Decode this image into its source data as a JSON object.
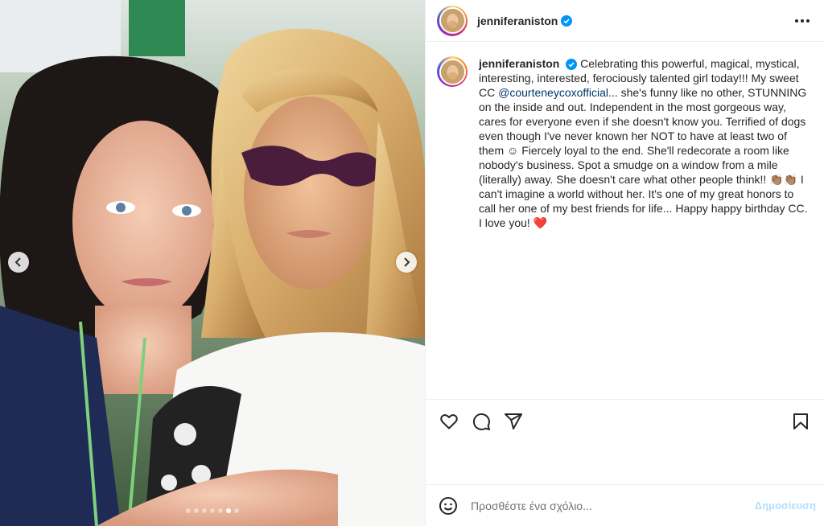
{
  "post": {
    "username": "jenniferaniston",
    "verified": true,
    "caption": {
      "username": "jenniferaniston",
      "text_before_mention": " Celebrating this powerful, magical, mystical, interesting, interested, ferociously talented girl today!!! My sweet CC ",
      "mention": "@courteneycoxofficial",
      "text_after_mention": "... she's funny like no other, STUNNING on the inside and out. Independent in the most gorgeous way, cares for everyone even if she doesn't know you. Terrified of dogs even though I've never known her NOT to have at least two of them ☺ Fiercely loyal to the end. She'll redecorate a room like nobody's business. Spot a smudge on a window from a mile (literally) away. She doesn't care what other people think!! 👏🏽👏🏽 I can't imagine a world without her. It's one of my great honors to call her one of my best friends for life... Happy happy birthday CC. I love you! ",
      "heart": "❤️"
    }
  },
  "carousel": {
    "total_slides": 7,
    "active_index": 5
  },
  "icons": {
    "like": "heart-outline-icon",
    "comment": "comment-bubble-icon",
    "share": "paper-plane-icon",
    "save": "bookmark-icon",
    "emoji": "smiley-icon",
    "more": "more-dots-icon",
    "verified": "verified-badge-icon"
  },
  "colors": {
    "verified": "#0095f6",
    "post_button_disabled": "#b2dffc",
    "mention": "#00376b",
    "heart": "#e0245e"
  },
  "comment_box": {
    "placeholder": "Προσθέστε ένα σχόλιο...",
    "post_label": "Δημοσίευση"
  }
}
